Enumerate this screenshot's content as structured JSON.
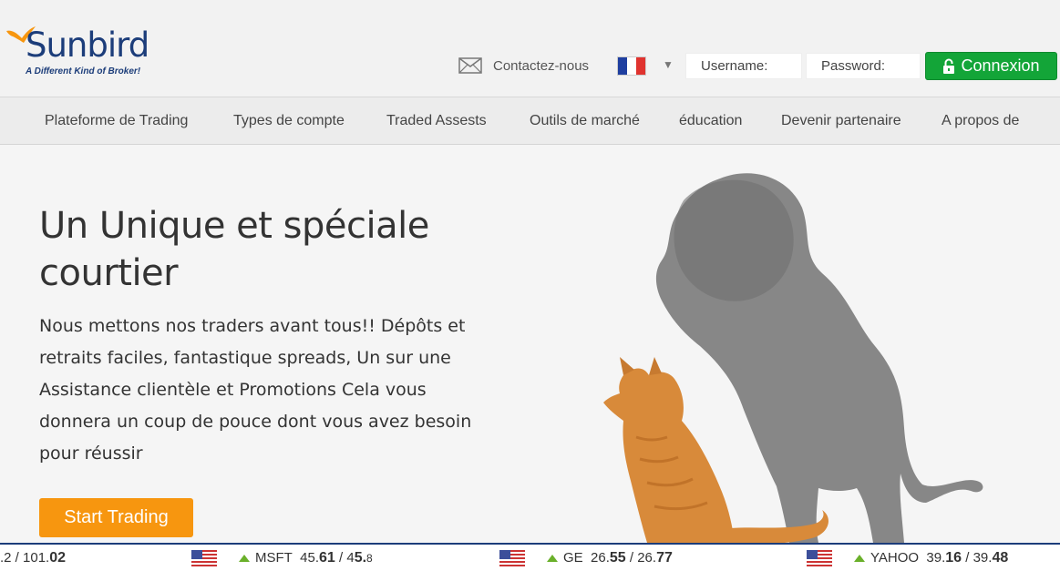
{
  "brand": {
    "name": "Sunbird",
    "tagline": "A Different Kind of Broker!"
  },
  "header": {
    "contact_label": "Contactez-nous",
    "username_placeholder": "Username:",
    "password_placeholder": "Password:",
    "login_label": "Connexion"
  },
  "nav": {
    "items": [
      {
        "label": "Plateforme de Trading"
      },
      {
        "label": "Types de compte"
      },
      {
        "label": "Traded Assests"
      },
      {
        "label": "Outils de marché"
      },
      {
        "label": "éducation"
      },
      {
        "label": "Devenir partenaire"
      },
      {
        "label": "A propos de"
      }
    ]
  },
  "hero": {
    "title": "Un Unique et spéciale courtier",
    "text": "Nous mettons nos traders avant tous!! Dépôts et retraits faciles, fantastique spreads, Un sur une Assistance clientèle et Promotions Cela vous donnera un coup de pouce dont vous avez besoin pour réussir",
    "cta_label": "Start Trading"
  },
  "ticker": {
    "items": [
      {
        "symbol": "",
        "bid_a": ".2",
        "ask_a": "101.",
        "ask_b": "02"
      },
      {
        "symbol": "MSFT",
        "bid_a": "45.",
        "bid_b": "61",
        "ask_a": "4",
        "ask_b": "5.",
        "ask_c": "8"
      },
      {
        "symbol": "GE",
        "bid_a": "26.",
        "bid_b": "55",
        "ask_a": "26.",
        "ask_b": "77"
      },
      {
        "symbol": "YAHOO",
        "bid_a": "39.",
        "bid_b": "16",
        "ask_a": "39.",
        "ask_b": "48"
      }
    ]
  },
  "colors": {
    "brand_blue": "#1c3d7a",
    "login_green": "#13a538",
    "cta_orange": "#f7960f",
    "up_arrow": "#6ab02a"
  }
}
